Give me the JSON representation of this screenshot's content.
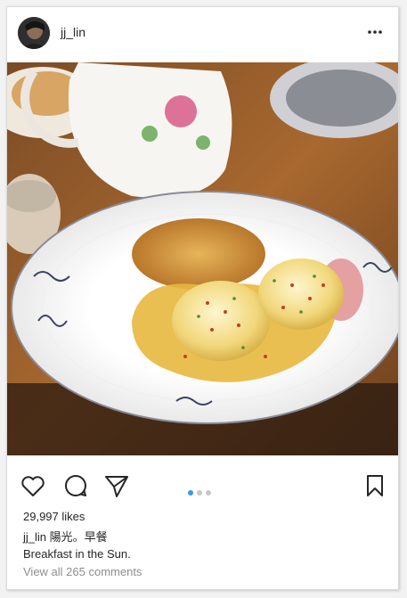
{
  "post": {
    "username": "jj_lin",
    "likes_text": "29,997 likes",
    "caption_user": "jj_lin",
    "caption_line1": "陽光。早餐",
    "caption_line2": "Breakfast in the Sun.",
    "view_all_comments": "View all 265 comments",
    "carousel": {
      "count": 3,
      "active_index": 0
    }
  },
  "icons": {
    "more": "more-horizontal-icon",
    "like": "heart-icon",
    "comment": "comment-bubble-icon",
    "share": "send-paper-plane-icon",
    "save": "bookmark-icon"
  },
  "colors": {
    "accent_blue": "#3897f0",
    "text": "#262626",
    "muted": "#8e8e8e"
  }
}
